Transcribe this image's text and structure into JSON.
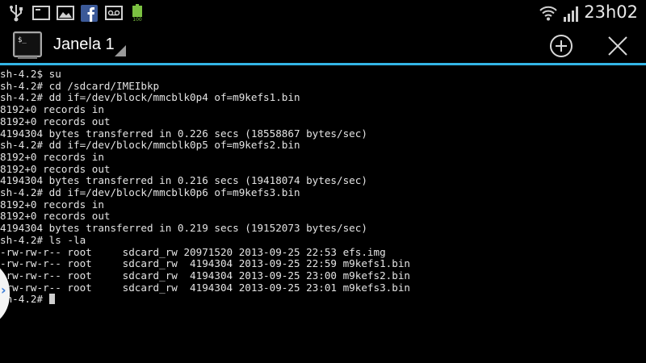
{
  "status_bar": {
    "time": "23h02",
    "battery_level_label": "100",
    "left_icons": [
      "usb-icon",
      "terminal-icon",
      "gallery-icon",
      "facebook-icon",
      "voicemail-icon",
      "battery-full-icon"
    ],
    "right_icons": [
      "wifi-icon",
      "signal-icon"
    ]
  },
  "action_bar": {
    "title": "Janela 1",
    "accent_color": "#33b5e5",
    "buttons": [
      "new-window-button",
      "close-window-button"
    ]
  },
  "terminal": {
    "lines": [
      "sh-4.2$ su",
      "sh-4.2# cd /sdcard/IMEIbkp",
      "sh-4.2# dd if=/dev/block/mmcblk0p4 of=m9kefs1.bin",
      "8192+0 records in",
      "8192+0 records out",
      "4194304 bytes transferred in 0.226 secs (18558867 bytes/sec)",
      "sh-4.2# dd if=/dev/block/mmcblk0p5 of=m9kefs2.bin",
      "8192+0 records in",
      "8192+0 records out",
      "4194304 bytes transferred in 0.216 secs (19418074 bytes/sec)",
      "sh-4.2# dd if=/dev/block/mmcblk0p6 of=m9kefs3.bin",
      "8192+0 records in",
      "8192+0 records out",
      "4194304 bytes transferred in 0.219 secs (19152073 bytes/sec)",
      "sh-4.2# ls -la",
      "-rw-rw-r-- root     sdcard_rw 20971520 2013-09-25 22:53 efs.img",
      "-rw-rw-r-- root     sdcard_rw  4194304 2013-09-25 22:59 m9kefs1.bin",
      "-rw-rw-r-- root     sdcard_rw  4194304 2013-09-25 23:00 m9kefs2.bin",
      "-rw-rw-r-- root     sdcard_rw  4194304 2013-09-25 23:01 m9kefs3.bin"
    ],
    "prompt": "sh-4.2# "
  },
  "edge_panel": {
    "chevron": "›"
  }
}
